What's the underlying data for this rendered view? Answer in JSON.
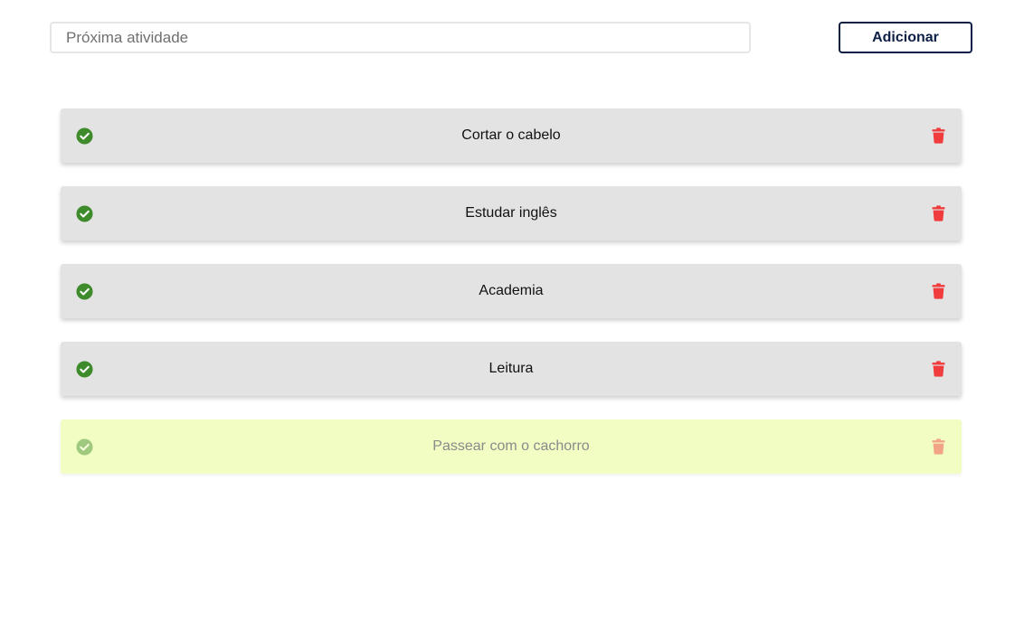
{
  "new_task": {
    "placeholder": "Próxima atividade",
    "value": ""
  },
  "add_button_label": "Adicionar",
  "tasks": [
    {
      "label": "Cortar o cabelo",
      "done": false
    },
    {
      "label": "Estudar inglês",
      "done": false
    },
    {
      "label": "Academia",
      "done": false
    },
    {
      "label": "Leitura",
      "done": false
    },
    {
      "label": "Passear com o cachorro",
      "done": true
    }
  ],
  "icons": {
    "complete": "check-circle-icon",
    "delete": "trash-icon"
  },
  "colors": {
    "accent": "#0d1f45",
    "check": "#3d8b2a",
    "delete": "#f03c3c",
    "item_bg": "#e3e3e3",
    "item_done_bg": "#f2fdc4"
  }
}
